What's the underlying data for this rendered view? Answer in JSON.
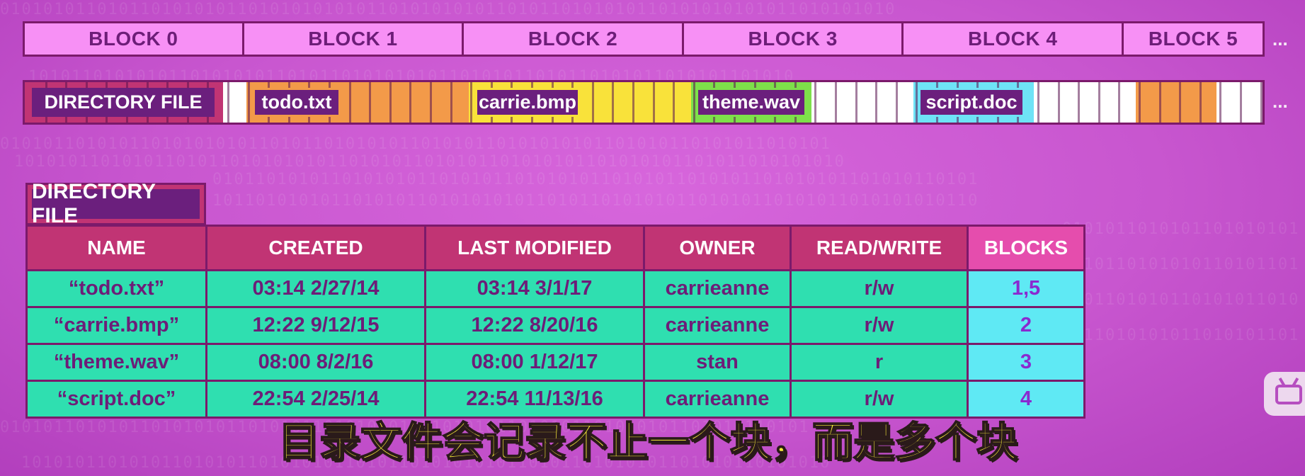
{
  "block_row": {
    "blocks": [
      "BLOCK 0",
      "BLOCK 1",
      "BLOCK 2",
      "BLOCK 3",
      "BLOCK 4",
      "BLOCK 5"
    ],
    "more": "..."
  },
  "disk_strip": {
    "directory_label": "DIRECTORY FILE",
    "files": [
      {
        "name": "todo.txt",
        "color": "#f39a49"
      },
      {
        "name": "carrie.bmp",
        "color": "#f9e23a"
      },
      {
        "name": "theme.wav",
        "color": "#7ee04a"
      },
      {
        "name": "script.doc",
        "color": "#6ee3f6"
      }
    ],
    "more": "..."
  },
  "directory_table": {
    "title": "DIRECTORY FILE",
    "headers": {
      "name": "NAME",
      "created": "CREATED",
      "last_modified": "LAST MODIFIED",
      "owner": "OWNER",
      "read_write": "READ/WRITE",
      "blocks": "BLOCKS"
    },
    "rows": [
      {
        "name": "“todo.txt”",
        "created": "03:14 2/27/14",
        "last_modified": "03:14 3/1/17",
        "owner": "carrieanne",
        "read_write": "r/w",
        "blocks": "1,5"
      },
      {
        "name": "“carrie.bmp”",
        "created": "12:22 9/12/15",
        "last_modified": "12:22 8/20/16",
        "owner": "carrieanne",
        "read_write": "r/w",
        "blocks": "2"
      },
      {
        "name": "“theme.wav”",
        "created": "08:00 8/2/16",
        "last_modified": "08:00 1/12/17",
        "owner": "stan",
        "read_write": "r",
        "blocks": "3"
      },
      {
        "name": "“script.doc”",
        "created": "22:54 2/25/14",
        "last_modified": "22:54 11/13/16",
        "owner": "carrieanne",
        "read_write": "r/w",
        "blocks": "4"
      }
    ]
  },
  "subtitle": "目录文件会记录不止一个块，而是多个块",
  "colors": {
    "background": "#c856cf",
    "directory": "#c13474",
    "free": "#ffffff",
    "table_cell": "#2fdfb0",
    "blocks_cell": "#5fe9f4"
  }
}
